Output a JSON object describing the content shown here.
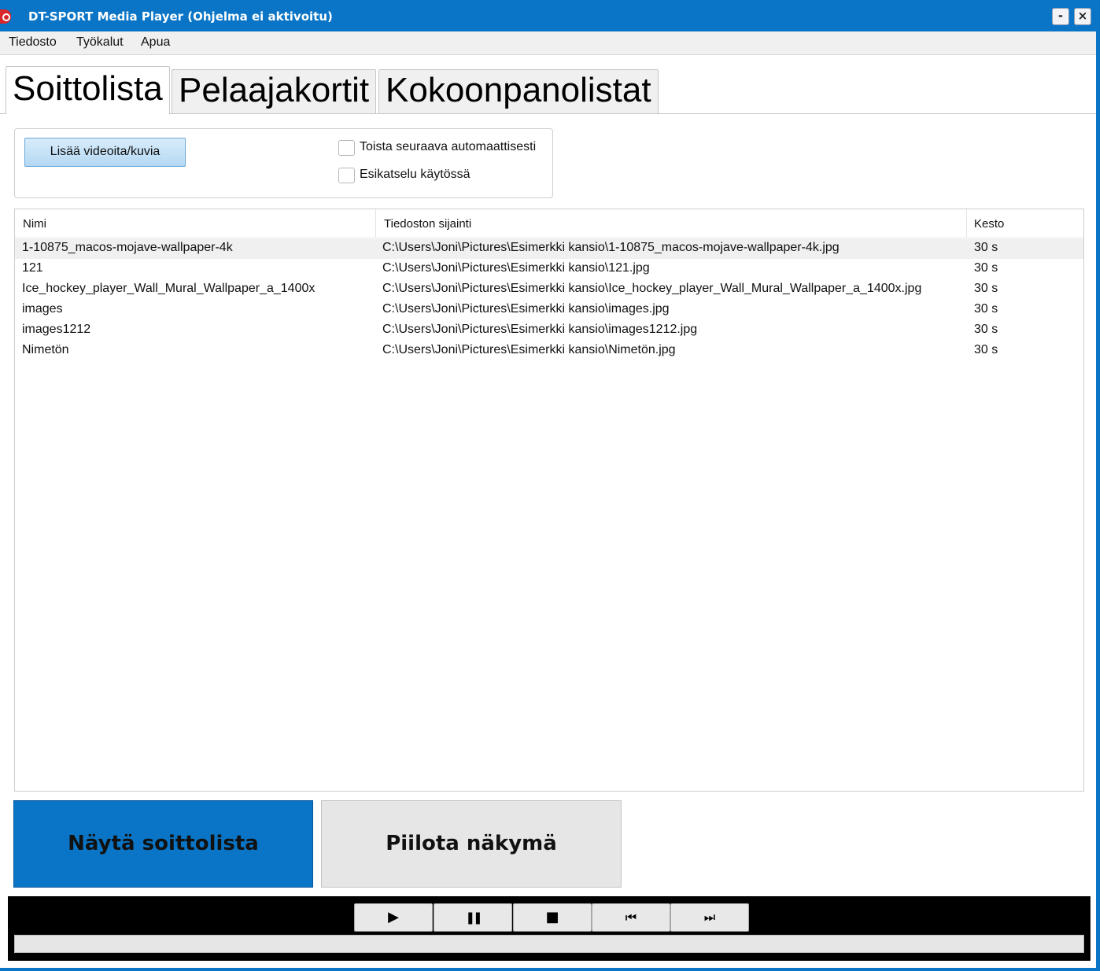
{
  "window": {
    "title": "DT-SPORT Media Player (Ohjelma ei aktivoitu)",
    "minimize_glyph": "-",
    "close_glyph": "×"
  },
  "menu": [
    "Tiedosto",
    "Työkalut",
    "Apua"
  ],
  "tabs": [
    {
      "label": "Soittolista",
      "active": true
    },
    {
      "label": "Pelaajakortit",
      "active": false
    },
    {
      "label": "Kokoonpanolistat",
      "active": false
    }
  ],
  "playlist_options": {
    "add_button": "Lisää videoita/kuvia",
    "autoplay_label": "Toista seuraava automaattisesti",
    "autoplay_checked": false,
    "preview_label": "Esikatselu käytössä",
    "preview_checked": false
  },
  "table": {
    "columns": [
      "Nimi",
      "Tiedoston sijainti",
      "Kesto"
    ],
    "rows": [
      [
        "1-10875_macos-mojave-wallpaper-4k",
        "C:\\Users\\Joni\\Pictures\\Esimerkki kansio\\1-10875_macos-mojave-wallpaper-4k.jpg",
        "30 s"
      ],
      [
        "121",
        "C:\\Users\\Joni\\Pictures\\Esimerkki kansio\\121.jpg",
        "30 s"
      ],
      [
        "Ice_hockey_player_Wall_Mural_Wallpaper_a_1400x",
        "C:\\Users\\Joni\\Pictures\\Esimerkki kansio\\Ice_hockey_player_Wall_Mural_Wallpaper_a_1400x.jpg",
        "30 s"
      ],
      [
        "images",
        "C:\\Users\\Joni\\Pictures\\Esimerkki kansio\\images.jpg",
        "30 s"
      ],
      [
        "images1212",
        "C:\\Users\\Joni\\Pictures\\Esimerkki kansio\\images1212.jpg",
        "30 s"
      ],
      [
        "Nimetön",
        "C:\\Users\\Joni\\Pictures\\Esimerkki kansio\\Nimetön.jpg",
        "30 s"
      ]
    ],
    "selected_row": 0
  },
  "view_buttons": {
    "show": "Näytä soittolista",
    "hide": "Piilota näkymä"
  },
  "playback": {
    "play": "▶",
    "pause": "❚❚",
    "stop": "■",
    "previous": "⏮",
    "next": "⏭",
    "progress": 0
  },
  "colors": {
    "accent": "#0a75c6",
    "control_bar": "#000000"
  }
}
